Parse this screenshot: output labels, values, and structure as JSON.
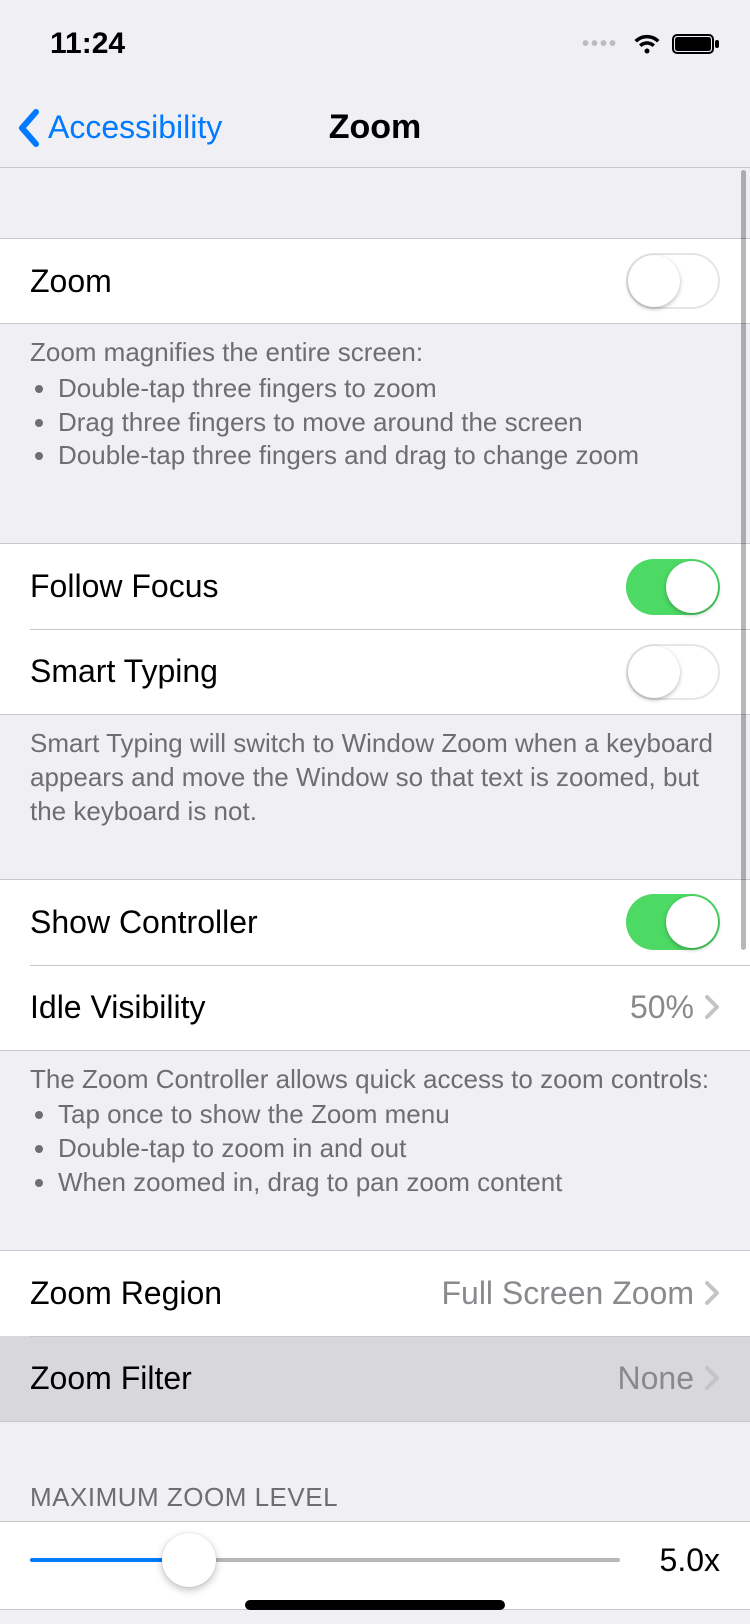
{
  "status": {
    "time": "11:24"
  },
  "nav": {
    "back_label": "Accessibility",
    "title": "Zoom"
  },
  "zoom": {
    "label": "Zoom",
    "on": false,
    "help_intro": "Zoom magnifies the entire screen:",
    "help_items": [
      "Double-tap three fingers to zoom",
      "Drag three fingers to move around the screen",
      "Double-tap three fingers and drag to change zoom"
    ]
  },
  "follow_focus": {
    "label": "Follow Focus",
    "on": true
  },
  "smart_typing": {
    "label": "Smart Typing",
    "on": false,
    "help": "Smart Typing will switch to Window Zoom when a keyboard appears and move the Window so that text is zoomed, but the keyboard is not."
  },
  "show_controller": {
    "label": "Show Controller",
    "on": true
  },
  "idle_visibility": {
    "label": "Idle Visibility",
    "value": "50%"
  },
  "controller_help": {
    "intro": "The Zoom Controller allows quick access to zoom controls:",
    "items": [
      "Tap once to show the Zoom menu",
      "Double-tap to zoom in and out",
      "When zoomed in, drag to pan zoom content"
    ]
  },
  "zoom_region": {
    "label": "Zoom Region",
    "value": "Full Screen Zoom"
  },
  "zoom_filter": {
    "label": "Zoom Filter",
    "value": "None"
  },
  "max_zoom": {
    "header": "MAXIMUM ZOOM LEVEL",
    "value_label": "5.0x",
    "fill_percent": 27
  }
}
